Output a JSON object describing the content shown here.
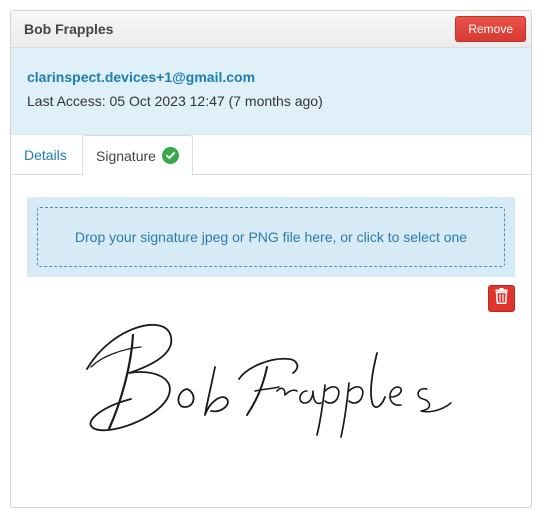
{
  "header": {
    "user_name": "Bob Frapples",
    "remove_label": "Remove"
  },
  "info": {
    "email": "clarinspect.devices+1@gmail.com",
    "last_access": "Last Access: 05 Oct 2023 12:47 (7 months ago)"
  },
  "tabs": [
    {
      "label": "Details",
      "active": false
    },
    {
      "label": "Signature",
      "active": true,
      "status_icon": "check-circle-icon"
    }
  ],
  "dropzone": {
    "text": "Drop your signature jpeg or PNG file here, or click to select one"
  },
  "signature": {
    "delete_icon": "trash-icon"
  },
  "colors": {
    "accent": "#1a7db3",
    "danger": "#e0342d",
    "info_bg": "#dff0f8",
    "success": "#39a84a"
  }
}
